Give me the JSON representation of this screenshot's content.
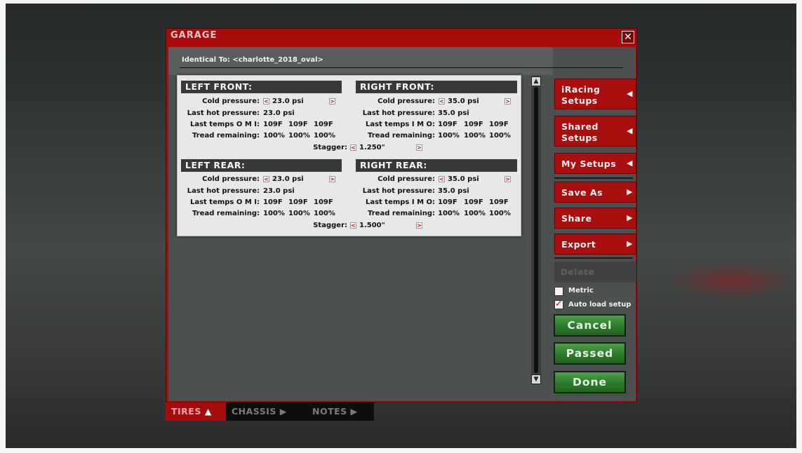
{
  "window": {
    "title": "GARAGE",
    "close_icon": "close-icon"
  },
  "identical_to": "Identical To: <charlotte_2018_oval>",
  "tires": {
    "left_front": {
      "header": "LEFT FRONT:",
      "cold_pressure_label": "Cold pressure:",
      "cold_pressure": "23.0 psi",
      "last_hot_label": "Last hot pressure:",
      "last_hot": "23.0 psi",
      "temps_label": "Last temps O M I:",
      "temps": [
        "109F",
        "109F",
        "109F"
      ],
      "tread_label": "Tread remaining:",
      "tread": [
        "100%",
        "100%",
        "100%"
      ]
    },
    "right_front": {
      "header": "RIGHT FRONT:",
      "cold_pressure_label": "Cold pressure:",
      "cold_pressure": "35.0 psi",
      "last_hot_label": "Last hot pressure:",
      "last_hot": "35.0 psi",
      "temps_label": "Last temps I M O:",
      "temps": [
        "109F",
        "109F",
        "109F"
      ],
      "tread_label": "Tread remaining:",
      "tread": [
        "100%",
        "100%",
        "100%"
      ]
    },
    "front_stagger": {
      "label": "Stagger:",
      "value": "1.250\""
    },
    "left_rear": {
      "header": "LEFT REAR:",
      "cold_pressure_label": "Cold pressure:",
      "cold_pressure": "23.0 psi",
      "last_hot_label": "Last hot pressure:",
      "last_hot": "23.0 psi",
      "temps_label": "Last temps O M I:",
      "temps": [
        "109F",
        "109F",
        "109F"
      ],
      "tread_label": "Tread remaining:",
      "tread": [
        "100%",
        "100%",
        "100%"
      ]
    },
    "right_rear": {
      "header": "RIGHT REAR:",
      "cold_pressure_label": "Cold pressure:",
      "cold_pressure": "35.0 psi",
      "last_hot_label": "Last hot pressure:",
      "last_hot": "35.0 psi",
      "temps_label": "Last temps I M O:",
      "temps": [
        "109F",
        "109F",
        "109F"
      ],
      "tread_label": "Tread remaining:",
      "tread": [
        "100%",
        "100%",
        "100%"
      ]
    },
    "rear_stagger": {
      "label": "Stagger:",
      "value": "1.500\""
    }
  },
  "sidebar": {
    "iracing_setups": [
      "iRacing",
      "Setups"
    ],
    "shared_setups": [
      "Shared",
      "Setups"
    ],
    "my_setups": "My Setups",
    "save_as": "Save As",
    "share": "Share",
    "export": "Export",
    "delete": "Delete",
    "metric_label": "Metric",
    "metric_checked": false,
    "auto_load_label": "Auto load setup",
    "auto_load_checked": true,
    "cancel": "Cancel",
    "passed": "Passed",
    "done": "Done"
  },
  "tabs": [
    {
      "label": "TIRES",
      "active": true
    },
    {
      "label": "CHASSIS",
      "active": false
    },
    {
      "label": "NOTES",
      "active": false
    }
  ],
  "colors": {
    "accent_red": "#a60c0c",
    "button_green": "#2c7a2b"
  }
}
